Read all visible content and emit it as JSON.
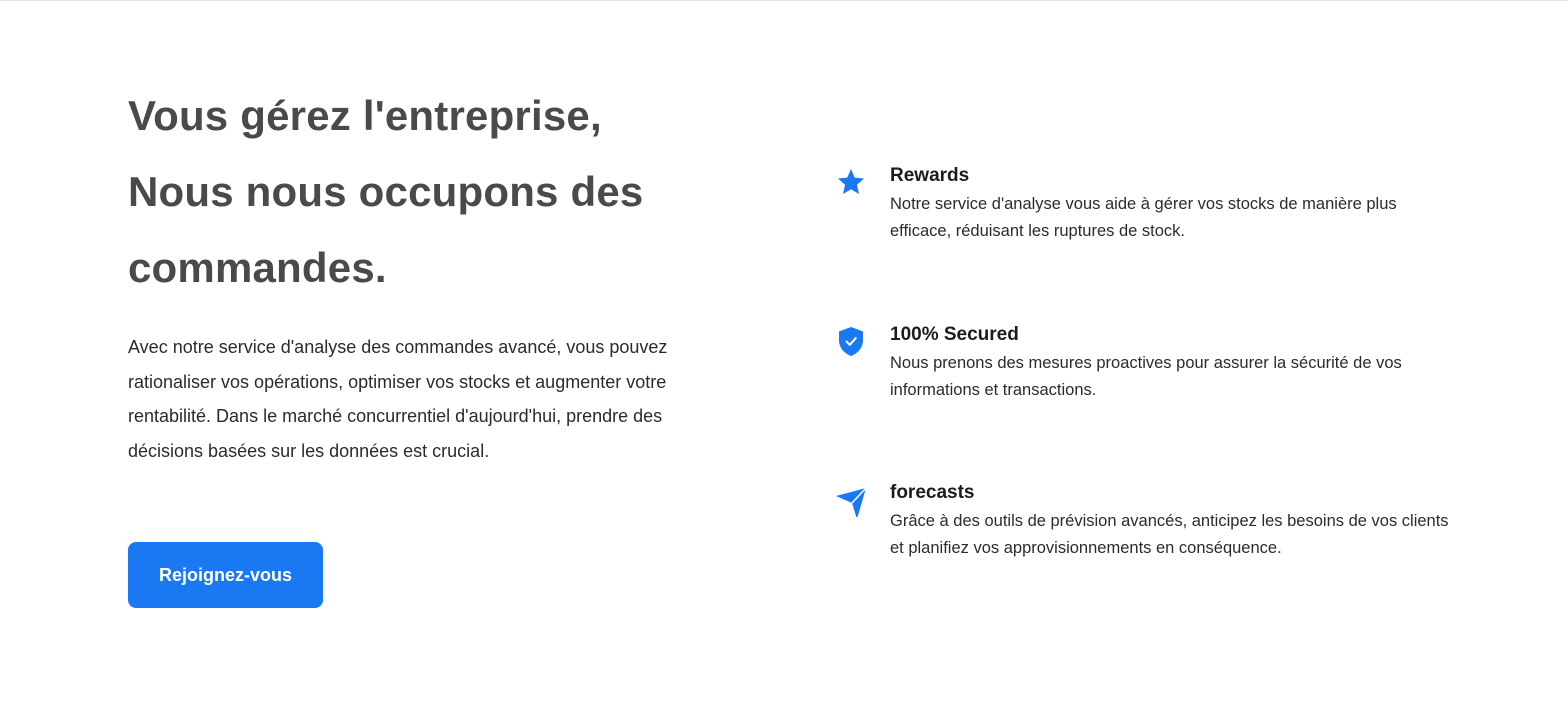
{
  "hero": {
    "headline_line1": "Vous gérez l'entreprise,",
    "headline_line2": "Nous nous occupons des",
    "headline_line3": "commandes.",
    "lead": "Avec notre service d'analyse des commandes avancé, vous pouvez rationaliser vos opérations, optimiser vos stocks et augmenter votre rentabilité. Dans le marché concurrentiel d'aujourd'hui, prendre des décisions basées sur les données est crucial.",
    "cta_label": "Rejoignez-vous"
  },
  "features": [
    {
      "icon": "star-icon",
      "title": "Rewards",
      "description": "Notre service d'analyse vous aide à gérer vos stocks de manière plus efficace, réduisant les ruptures de stock."
    },
    {
      "icon": "shield-check-icon",
      "title": "100% Secured",
      "description": "Nous prenons des mesures proactives pour assurer la sécurité de vos informations et transactions."
    },
    {
      "icon": "paper-plane-icon",
      "title": "forecasts",
      "description": "Grâce à des outils de prévision avancés, anticipez les besoins de vos clients et planifiez vos approvisionnements en conséquence."
    }
  ],
  "colors": {
    "accent": "#1a78f2",
    "headline": "#4a4a4a",
    "body_text": "#2b2b2b",
    "background": "#ffffff"
  }
}
